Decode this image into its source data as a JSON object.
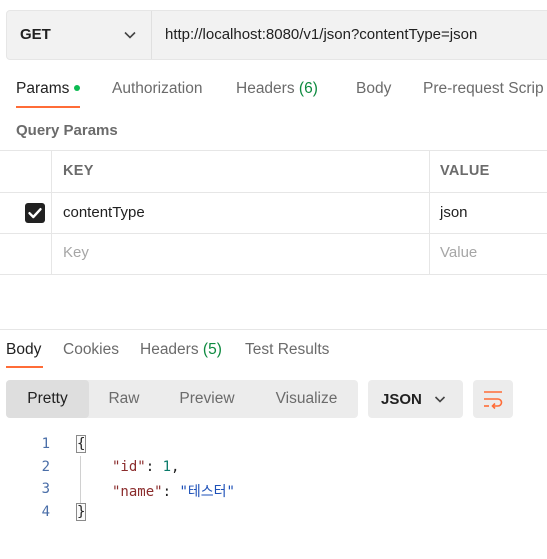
{
  "request": {
    "method": "GET",
    "url": "http://localhost:8080/v1/json?contentType=json"
  },
  "request_tabs": [
    {
      "label": "Params",
      "active": true,
      "indicator_dot": true
    },
    {
      "label": "Authorization",
      "active": false
    },
    {
      "label": "Headers",
      "count": "(6)",
      "active": false
    },
    {
      "label": "Body",
      "active": false
    },
    {
      "label": "Pre-request Scrip",
      "active": false
    }
  ],
  "query_params": {
    "section_title": "Query Params",
    "headers": {
      "key": "KEY",
      "value": "VALUE"
    },
    "rows": [
      {
        "checked": true,
        "key": "contentType",
        "value": "json"
      }
    ],
    "new_row_placeholder": {
      "key": "Key",
      "value": "Value"
    }
  },
  "response_tabs": [
    {
      "label": "Body",
      "active": true
    },
    {
      "label": "Cookies",
      "active": false
    },
    {
      "label": "Headers",
      "count": "(5)",
      "active": false
    },
    {
      "label": "Test Results",
      "active": false
    }
  ],
  "view_modes": [
    {
      "label": "Pretty",
      "active": true
    },
    {
      "label": "Raw",
      "active": false
    },
    {
      "label": "Preview",
      "active": false
    },
    {
      "label": "Visualize",
      "active": false
    }
  ],
  "format_select": {
    "value": "JSON"
  },
  "icons": {
    "method_dropdown": "chevron-down-icon",
    "format_dropdown": "chevron-down-icon",
    "wrap_lines": "wrap-lines-icon",
    "checkbox": "check-icon"
  },
  "colors": {
    "accent": "#ff6c37",
    "status_dot": "#0cbb52",
    "count_text": "#0d8a3f"
  },
  "response_body": {
    "line_numbers": [
      "1",
      "2",
      "3",
      "4"
    ],
    "open_brace": "{",
    "close_brace": "}",
    "fields": [
      {
        "key": "\"id\"",
        "value": "1",
        "trailing": ","
      },
      {
        "key": "\"name\"",
        "value": "\"테스터\"",
        "trailing": ""
      }
    ]
  }
}
